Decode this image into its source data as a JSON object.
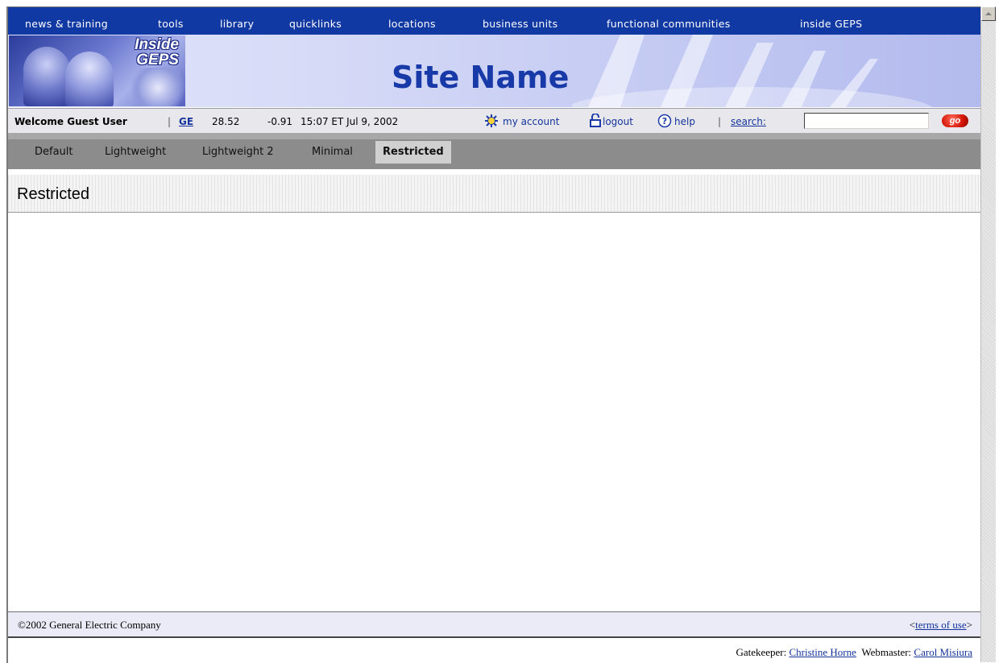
{
  "topnav": {
    "items": [
      {
        "label": "news & training"
      },
      {
        "label": "tools"
      },
      {
        "label": "library"
      },
      {
        "label": "quicklinks"
      },
      {
        "label": "locations"
      },
      {
        "label": "business units"
      },
      {
        "label": "functional communities"
      },
      {
        "label": "inside GEPS"
      }
    ],
    "color": "#1139a4"
  },
  "banner": {
    "logo_line1": "Inside",
    "logo_line2": "GEPS",
    "site_name": "Site Name"
  },
  "welcome": {
    "greeting": "Welcome Guest User",
    "separator": "|",
    "ticker": "GE",
    "price": "28.52",
    "change": "-0.91",
    "timestamp": "15:07 ET Jul 9, 2002",
    "my_account": "my account",
    "logout": "logout",
    "help": "help",
    "search_label": "search:",
    "search_value": "",
    "go": "go"
  },
  "tabs": [
    {
      "label": "Default",
      "active": false
    },
    {
      "label": "Lightweight",
      "active": false
    },
    {
      "label": "Lightweight 2",
      "active": false
    },
    {
      "label": "Minimal",
      "active": false
    },
    {
      "label": "Restricted",
      "active": true
    }
  ],
  "page": {
    "title": "Restricted"
  },
  "footer": {
    "copyright": "©2002 General Electric Company",
    "terms_prefix": "<",
    "terms": "terms of use",
    "terms_suffix": ">",
    "gatekeeper_label": "Gatekeeper:",
    "gatekeeper_name": "Christine Horne",
    "webmaster_label": "Webmaster:",
    "webmaster_name": "Carol Misiura"
  }
}
